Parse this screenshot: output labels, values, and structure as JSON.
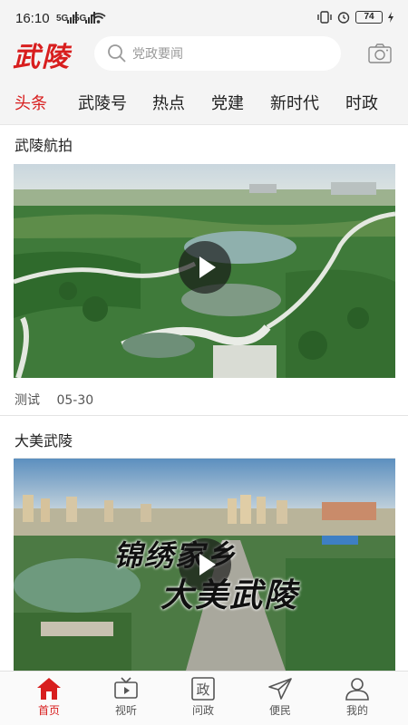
{
  "status_bar": {
    "time": "16:10",
    "signal_1": "5G",
    "signal_2": "5G",
    "battery": "74",
    "icons": [
      "signal-icon",
      "wifi-icon",
      "vibrate-icon",
      "alarm-icon",
      "battery-icon",
      "charging-icon"
    ]
  },
  "header": {
    "logo": "武陵",
    "search_placeholder": "党政要闻",
    "icons": [
      "search-icon",
      "camera-icon"
    ]
  },
  "tabs": [
    {
      "label": "头条",
      "active": true
    },
    {
      "label": "武陵号",
      "active": false
    },
    {
      "label": "热点",
      "active": false
    },
    {
      "label": "党建",
      "active": false
    },
    {
      "label": "新时代",
      "active": false
    },
    {
      "label": "时政",
      "active": false
    }
  ],
  "feed": [
    {
      "title": "武陵航拍",
      "author": "测试",
      "date": "05-30",
      "has_video": true
    },
    {
      "title": "大美武陵",
      "overlay_text_line1": "锦绣家乡",
      "overlay_text_line2": "大美武陵",
      "has_video": true
    }
  ],
  "bottom_nav": [
    {
      "label": "首页",
      "icon": "home-icon",
      "active": true
    },
    {
      "label": "视听",
      "icon": "tv-icon",
      "active": false
    },
    {
      "label": "问政",
      "icon": "zheng-icon",
      "active": false
    },
    {
      "label": "便民",
      "icon": "send-icon",
      "active": false
    },
    {
      "label": "我的",
      "icon": "user-icon",
      "active": false
    }
  ],
  "colors": {
    "accent": "#d81e1e",
    "background_bar": "#f4f4f4"
  }
}
